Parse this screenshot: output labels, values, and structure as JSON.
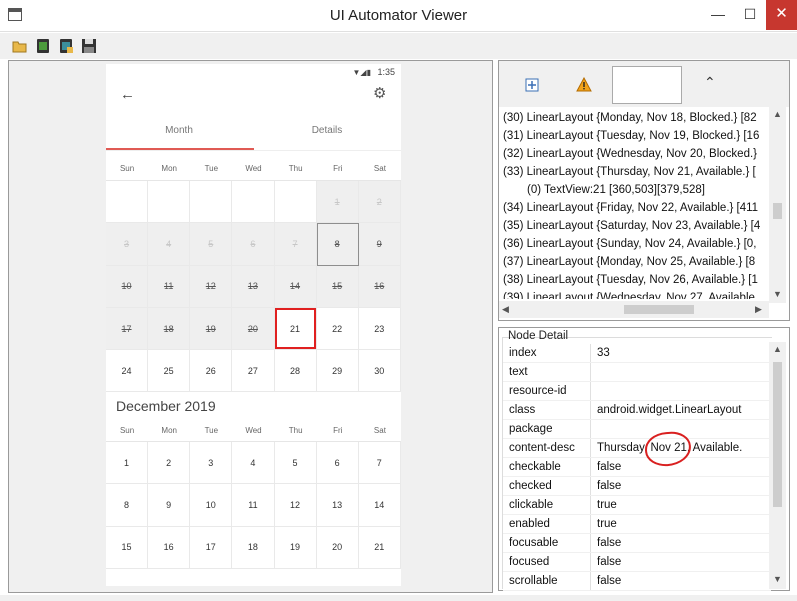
{
  "window": {
    "title": "UI Automator Viewer",
    "min": "—",
    "max": "☐",
    "close": "✕"
  },
  "toolbar": {
    "icons": [
      "open-folder-icon",
      "device-screenshot-icon",
      "device-screenshot-compressed-icon",
      "save-icon"
    ]
  },
  "phone": {
    "status_time": "1:35",
    "status_icons": "▼◢▮",
    "back": "←",
    "settings": "⚙",
    "tabs": [
      "Month",
      "Details"
    ],
    "weekdays": [
      "Sun",
      "Mon",
      "Tue",
      "Wed",
      "Thu",
      "Fri",
      "Sat"
    ],
    "november": [
      [
        "",
        "",
        "",
        "",
        "",
        "1",
        "2"
      ],
      [
        "3",
        "4",
        "5",
        "6",
        "7",
        "8",
        "9"
      ],
      [
        "10",
        "11",
        "12",
        "13",
        "14",
        "15",
        "16"
      ],
      [
        "17",
        "18",
        "19",
        "20",
        "21",
        "22",
        "23"
      ],
      [
        "24",
        "25",
        "26",
        "27",
        "28",
        "29",
        "30"
      ]
    ],
    "december_title": "December 2019",
    "december": [
      [
        "1",
        "2",
        "3",
        "4",
        "5",
        "6",
        "7"
      ],
      [
        "8",
        "9",
        "10",
        "11",
        "12",
        "13",
        "14"
      ],
      [
        "15",
        "16",
        "17",
        "18",
        "19",
        "20",
        "21"
      ]
    ]
  },
  "tree": {
    "rows": [
      "(30) LinearLayout {Monday, Nov 18, Blocked.} [82",
      "(31) LinearLayout {Tuesday, Nov 19, Blocked.} [16",
      "(32) LinearLayout {Wednesday, Nov 20, Blocked.}",
      "(33) LinearLayout {Thursday, Nov 21, Available.} [",
      "(0) TextView:21 [360,503][379,528]",
      "(34) LinearLayout {Friday, Nov 22, Available.} [411",
      "(35) LinearLayout {Saturday, Nov 23, Available.} [4",
      "(36) LinearLayout {Sunday, Nov 24, Available.} [0,",
      "(37) LinearLayout {Monday, Nov 25, Available.} [8",
      "(38) LinearLayout {Tuesday, Nov 26, Available.} [1",
      "(39) LinearLayout {Wednesday, Nov 27, Available"
    ]
  },
  "node_detail": {
    "title": "Node Detail",
    "rows": [
      [
        "index",
        "33"
      ],
      [
        "text",
        ""
      ],
      [
        "resource-id",
        ""
      ],
      [
        "class",
        "android.widget.LinearLayout"
      ],
      [
        "package",
        ""
      ],
      [
        "content-desc",
        "Thursday, Nov 21, Available."
      ],
      [
        "checkable",
        "false"
      ],
      [
        "checked",
        "false"
      ],
      [
        "clickable",
        "true"
      ],
      [
        "enabled",
        "true"
      ],
      [
        "focusable",
        "false"
      ],
      [
        "focused",
        "false"
      ],
      [
        "scrollable",
        "false"
      ]
    ]
  },
  "colors": {
    "selection_red": "#e02020",
    "tab_underline": "#e05a54",
    "close_red": "#c7372f"
  }
}
